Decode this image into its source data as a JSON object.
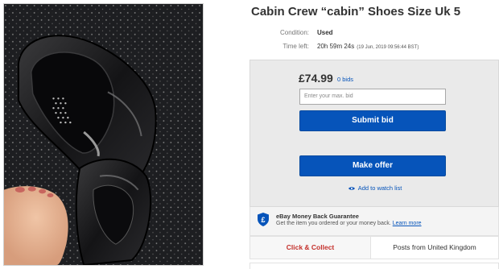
{
  "listing": {
    "title": "Cabin Crew “cabin” Shoes Size Uk 5",
    "condition_label": "Condition:",
    "condition_value": "Used",
    "time_label": "Time left:",
    "time_value": "20h 59m 24s",
    "time_detail": "(19 Jun, 2019  09:56:44 BST)"
  },
  "bidding": {
    "price": "£74.99",
    "bids": "0 bids",
    "max_bid_placeholder": "Enter your max. bid",
    "submit_label": "Submit bid",
    "offer_label": "Make offer",
    "watch_label": "Add to watch list"
  },
  "guarantee": {
    "title": "eBay Money Back Guarantee",
    "text": "Get the item you ordered or your money back.",
    "link": "Learn more"
  },
  "shipping_tabs": {
    "click_collect": "Click & Collect",
    "posts_from": "Posts from United Kingdom"
  },
  "colors": {
    "brand_blue": "#0654ba",
    "collect_red": "#c4302b",
    "panel_grey": "#eaeaea"
  },
  "icons": [
    "shield-icon",
    "eye-icon"
  ]
}
